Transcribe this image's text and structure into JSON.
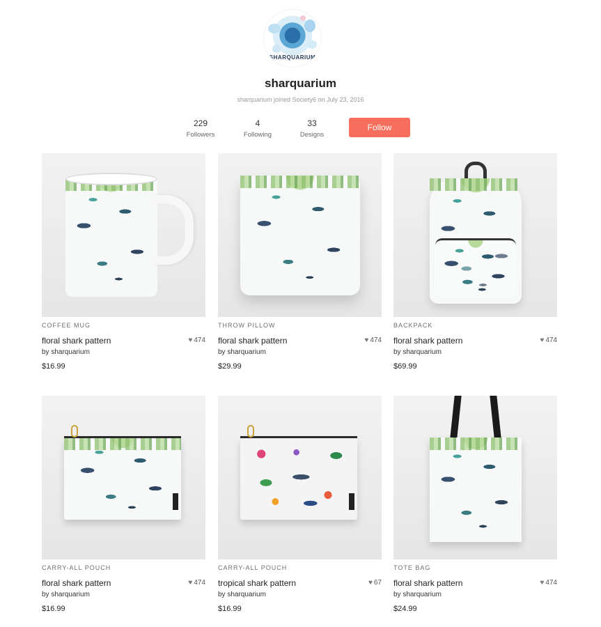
{
  "profile": {
    "avatar_text": "SHARQUARIUM",
    "username": "sharquarium",
    "joined": "sharquarium joined Society6 on July 23, 2016",
    "stats": {
      "followers": {
        "value": "229",
        "label": "Followers"
      },
      "following": {
        "value": "4",
        "label": "Following"
      },
      "designs": {
        "value": "33",
        "label": "Designs"
      }
    },
    "follow_label": "Follow",
    "follow_color": "#f76e5c"
  },
  "products": [
    {
      "type": "COFFEE MUG",
      "name": "floral shark pattern",
      "by": "by sharquarium",
      "likes": "474",
      "price": "$16.99"
    },
    {
      "type": "THROW PILLOW",
      "name": "floral shark pattern",
      "by": "by sharquarium",
      "likes": "474",
      "price": "$29.99"
    },
    {
      "type": "BACKPACK",
      "name": "floral shark pattern",
      "by": "by sharquarium",
      "likes": "474",
      "price": "$69.99"
    },
    {
      "type": "CARRY-ALL POUCH",
      "name": "floral shark pattern",
      "by": "by sharquarium",
      "likes": "474",
      "price": "$16.99"
    },
    {
      "type": "CARRY-ALL POUCH",
      "name": "tropical shark pattern",
      "by": "by sharquarium",
      "likes": "67",
      "price": "$16.99"
    },
    {
      "type": "TOTE BAG",
      "name": "floral shark pattern",
      "by": "by sharquarium",
      "likes": "474",
      "price": "$24.99"
    }
  ],
  "icons": {
    "like": "heart-icon"
  }
}
